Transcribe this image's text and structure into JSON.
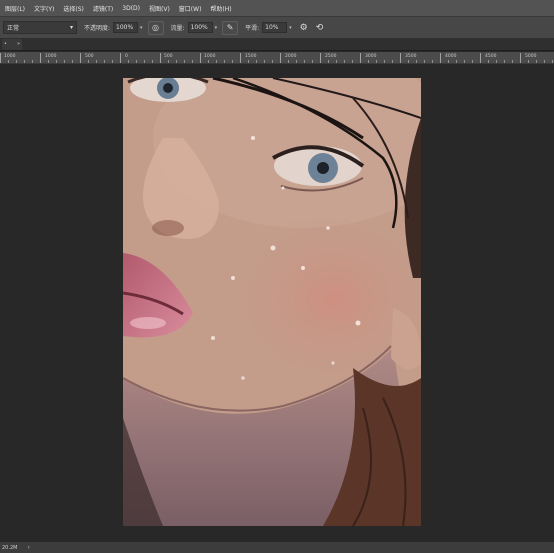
{
  "menubar": {
    "items": [
      "图层(L)",
      "文字(Y)",
      "选择(S)",
      "滤镜(T)",
      "3D(D)",
      "视图(V)",
      "窗口(W)",
      "帮助(H)"
    ]
  },
  "options": {
    "blend_mode": "正常",
    "opacity_label": "不透明度:",
    "opacity_value": "100%",
    "flow_label": "流量:",
    "flow_value": "100%",
    "smoothing_label": "平滑:",
    "smoothing_value": "10%"
  },
  "tab": {
    "arrows": "»"
  },
  "ruler": {
    "labels": [
      "1000",
      "1000",
      "500",
      "0",
      "500",
      "1000",
      "1500",
      "2000",
      "2500",
      "3000",
      "3500",
      "4000",
      "4500",
      "5000"
    ]
  },
  "status": {
    "zoom": "20.2M",
    "arrow": "›"
  },
  "colors": {
    "menubar": "#535353",
    "optionsbar": "#474747",
    "canvas_bg": "#282828",
    "ruler": "#4b4b4b"
  },
  "icons": [
    "brush-pressure-icon",
    "airbrush-icon",
    "gear-icon",
    "symmetry-icon"
  ]
}
